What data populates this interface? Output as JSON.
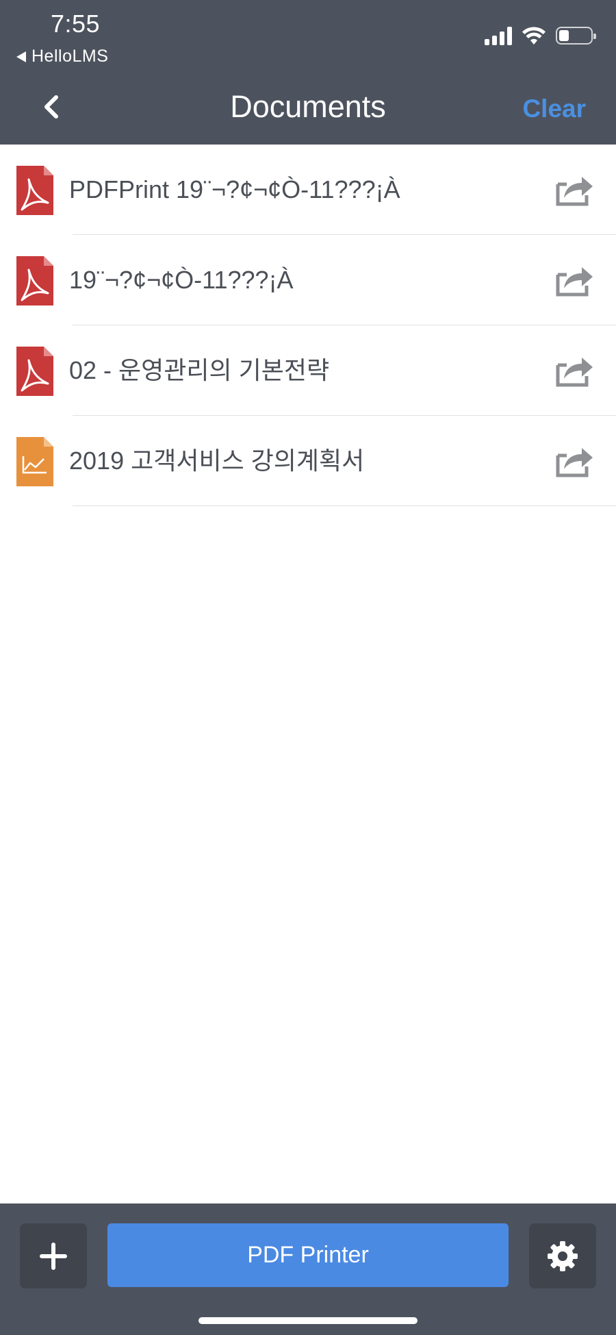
{
  "status_bar": {
    "time": "7:55",
    "back_app": "HelloLMS",
    "icons": [
      "signal-icon",
      "wifi-icon",
      "battery-icon"
    ]
  },
  "nav": {
    "back_icon": "chevron-left-icon",
    "title": "Documents",
    "clear_label": "Clear"
  },
  "documents": [
    {
      "name": "PDFPrint 19¨¬?¢¬¢Ò-11???¡À",
      "type": "pdf",
      "icon": "pdf-file-icon"
    },
    {
      "name": "19¨¬?¢¬¢Ò-11???¡À",
      "type": "pdf",
      "icon": "pdf-file-icon"
    },
    {
      "name": "02 - 운영관리의 기본전략",
      "type": "pdf",
      "icon": "pdf-file-icon"
    },
    {
      "name": "2019 고객서비스 강의계획서",
      "type": "chart",
      "icon": "chart-file-icon"
    }
  ],
  "toolbar": {
    "add_icon": "plus-icon",
    "primary_label": "PDF Printer",
    "settings_icon": "gear-icon"
  },
  "colors": {
    "header_bg": "#4d535e",
    "accent": "#4a90e2",
    "primary_button": "#4a8ae3",
    "pdf_icon": "#c8393a",
    "chart_icon": "#e8913d"
  }
}
